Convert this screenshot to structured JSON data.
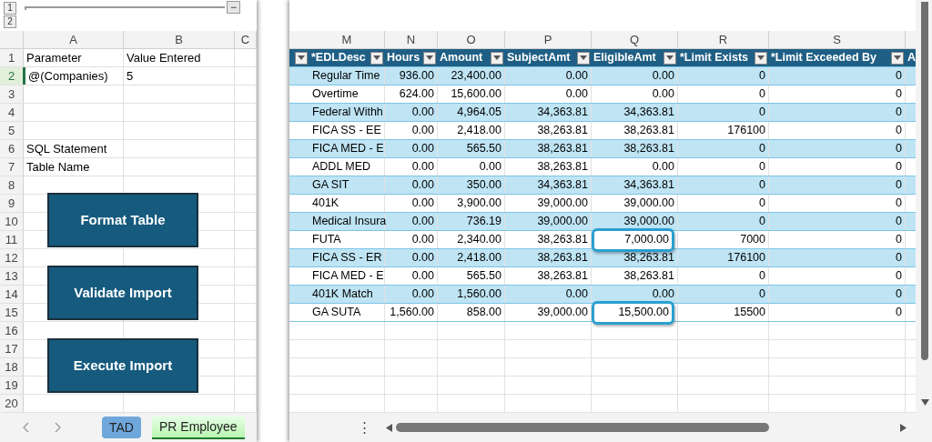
{
  "left_sheet": {
    "outline_levels": [
      "1",
      "2"
    ],
    "collapse_button": "−",
    "columns": [
      "A",
      "B",
      "C"
    ],
    "rows": [
      {
        "number": "1",
        "cells": [
          "Parameter",
          "Value Entered",
          ""
        ],
        "active": false
      },
      {
        "number": "2",
        "cells": [
          "@(Companies)",
          "5",
          ""
        ],
        "active": true
      },
      {
        "number": "3",
        "cells": [
          "",
          "",
          ""
        ],
        "active": false
      },
      {
        "number": "4",
        "cells": [
          "",
          "",
          ""
        ],
        "active": false
      },
      {
        "number": "5",
        "cells": [
          "",
          "",
          ""
        ],
        "active": false
      },
      {
        "number": "6",
        "cells": [
          "SQL Statement",
          "",
          ""
        ],
        "active": false
      },
      {
        "number": "7",
        "cells": [
          "Table Name",
          "",
          ""
        ],
        "active": false
      },
      {
        "number": "8",
        "cells": [
          "",
          "",
          ""
        ],
        "active": false
      },
      {
        "number": "9",
        "cells": [
          "",
          "",
          ""
        ],
        "active": false
      },
      {
        "number": "10",
        "cells": [
          "",
          "",
          ""
        ],
        "active": false
      },
      {
        "number": "11",
        "cells": [
          "",
          "",
          ""
        ],
        "active": false
      },
      {
        "number": "12",
        "cells": [
          "",
          "",
          ""
        ],
        "active": false
      },
      {
        "number": "13",
        "cells": [
          "",
          "",
          ""
        ],
        "active": false
      },
      {
        "number": "14",
        "cells": [
          "",
          "",
          ""
        ],
        "active": false
      },
      {
        "number": "15",
        "cells": [
          "",
          "",
          ""
        ],
        "active": false
      },
      {
        "number": "16",
        "cells": [
          "",
          "",
          ""
        ],
        "active": false
      },
      {
        "number": "17",
        "cells": [
          "",
          "",
          ""
        ],
        "active": false
      },
      {
        "number": "18",
        "cells": [
          "",
          "",
          ""
        ],
        "active": false
      },
      {
        "number": "19",
        "cells": [
          "",
          "",
          ""
        ],
        "active": false
      },
      {
        "number": "20",
        "cells": [
          "",
          "",
          ""
        ],
        "active": false
      }
    ],
    "buttons": [
      "Format Table",
      "Validate Import",
      "Execute Import"
    ],
    "sheet_tabs": [
      {
        "label": "TAD",
        "selected": false
      },
      {
        "label": "PR Employee",
        "selected": true
      }
    ]
  },
  "right_sheet": {
    "columns": [
      "M",
      "N",
      "O",
      "P",
      "Q",
      "R",
      "S"
    ],
    "headers": [
      "*EDLDesc",
      "Hours",
      "Amount",
      "SubjectAmt",
      "EligibleAmt",
      "*Limit Exists",
      "*Limit Exceeded By",
      "A"
    ],
    "rows": [
      {
        "cells": [
          "Regular Time",
          "936.00",
          "23,400.00",
          "0.00",
          "0.00",
          "0",
          "0"
        ],
        "boxed": [
          false,
          false,
          false,
          false,
          false,
          false,
          false
        ]
      },
      {
        "cells": [
          "Overtime",
          "624.00",
          "15,600.00",
          "0.00",
          "0.00",
          "0",
          "0"
        ],
        "boxed": [
          false,
          false,
          false,
          false,
          false,
          false,
          false
        ]
      },
      {
        "cells": [
          "Federal Withh",
          "0.00",
          "4,964.05",
          "34,363.81",
          "34,363.81",
          "0",
          "0"
        ],
        "boxed": [
          false,
          false,
          false,
          false,
          false,
          false,
          false
        ]
      },
      {
        "cells": [
          "FICA SS - EE",
          "0.00",
          "2,418.00",
          "38,263.81",
          "38,263.81",
          "176100",
          "0"
        ],
        "boxed": [
          false,
          false,
          false,
          false,
          false,
          false,
          false
        ]
      },
      {
        "cells": [
          "FICA MED - E",
          "0.00",
          "565.50",
          "38,263.81",
          "38,263.81",
          "0",
          "0"
        ],
        "boxed": [
          false,
          false,
          false,
          false,
          false,
          false,
          false
        ]
      },
      {
        "cells": [
          "ADDL MED",
          "0.00",
          "0.00",
          "38,263.81",
          "0.00",
          "0",
          "0"
        ],
        "boxed": [
          false,
          false,
          false,
          false,
          false,
          false,
          false
        ]
      },
      {
        "cells": [
          "GA SIT",
          "0.00",
          "350.00",
          "34,363.81",
          "34,363.81",
          "0",
          "0"
        ],
        "boxed": [
          false,
          false,
          false,
          false,
          false,
          false,
          false
        ]
      },
      {
        "cells": [
          "401K",
          "0.00",
          "3,900.00",
          "39,000.00",
          "39,000.00",
          "0",
          "0"
        ],
        "boxed": [
          false,
          false,
          false,
          false,
          false,
          false,
          false
        ]
      },
      {
        "cells": [
          "Medical Insura",
          "0.00",
          "736.19",
          "39,000.00",
          "39,000.00",
          "0",
          "0"
        ],
        "boxed": [
          false,
          false,
          false,
          false,
          false,
          false,
          false
        ]
      },
      {
        "cells": [
          "FUTA",
          "0.00",
          "2,340.00",
          "38,263.81",
          "7,000.00",
          "7000",
          "0"
        ],
        "boxed": [
          false,
          false,
          false,
          false,
          true,
          false,
          false
        ]
      },
      {
        "cells": [
          "FICA SS - ER",
          "0.00",
          "2,418.00",
          "38,263.81",
          "38,263.81",
          "176100",
          "0"
        ],
        "boxed": [
          false,
          false,
          false,
          false,
          false,
          false,
          false
        ]
      },
      {
        "cells": [
          "FICA MED - E",
          "0.00",
          "565.50",
          "38,263.81",
          "38,263.81",
          "0",
          "0"
        ],
        "boxed": [
          false,
          false,
          false,
          false,
          false,
          false,
          false
        ]
      },
      {
        "cells": [
          "401K Match",
          "0.00",
          "1,560.00",
          "0.00",
          "0.00",
          "0",
          "0"
        ],
        "boxed": [
          false,
          false,
          false,
          false,
          false,
          false,
          false
        ]
      },
      {
        "cells": [
          "GA SUTA",
          "1,560.00",
          "858.00",
          "39,000.00",
          "15,500.00",
          "15500",
          "0"
        ],
        "boxed": [
          false,
          false,
          false,
          false,
          true,
          false,
          false
        ]
      }
    ],
    "more_sheets_button": "⋮"
  }
}
